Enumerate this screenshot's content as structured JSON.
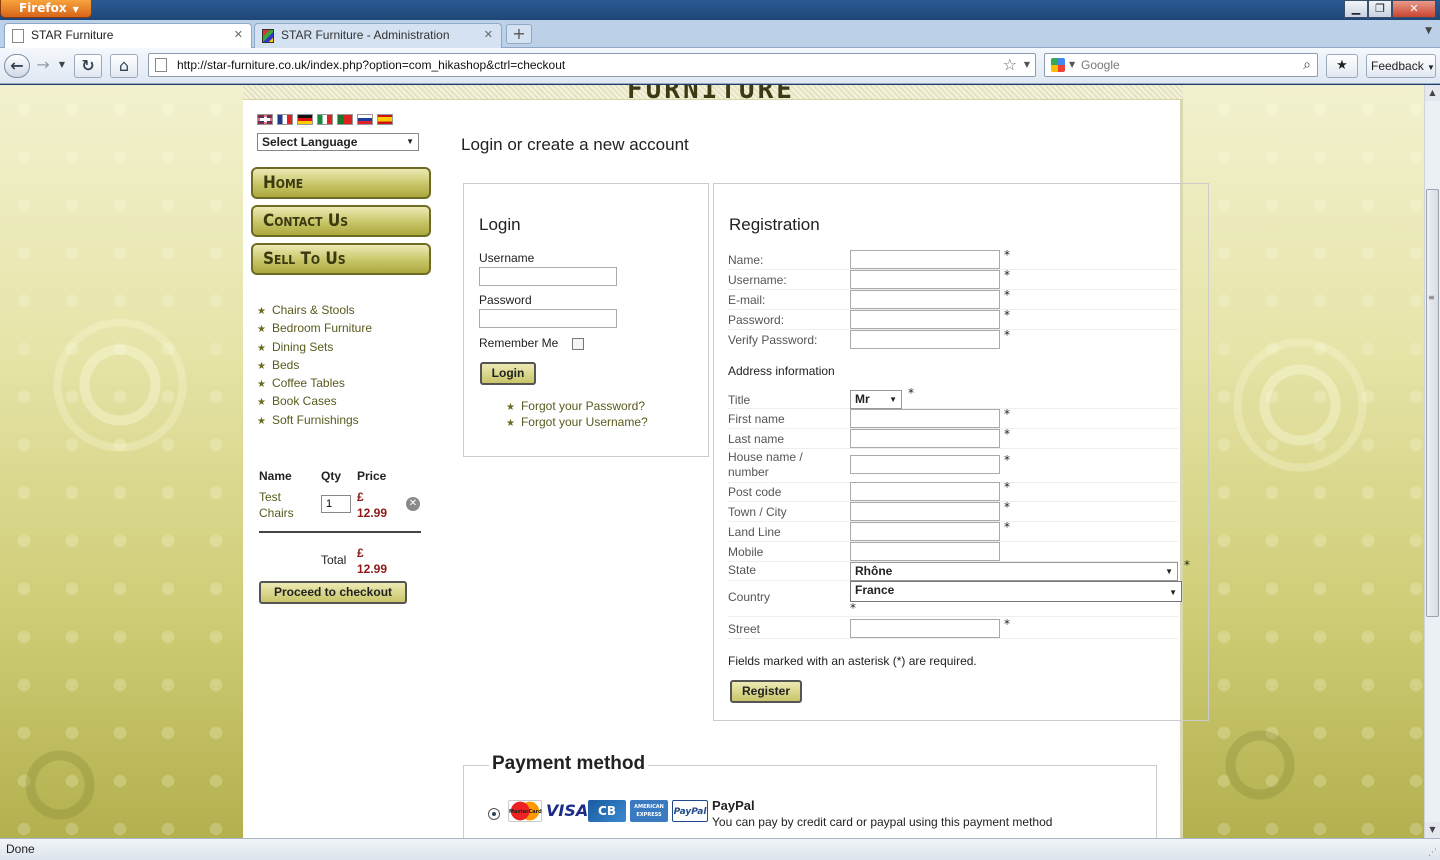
{
  "browser": {
    "app_button": "Firefox",
    "tabs": [
      {
        "label": "STAR Furniture",
        "active": true
      },
      {
        "label": "STAR Furniture - Administration",
        "active": false
      }
    ],
    "url": "http://star-furniture.co.uk/index.php?option=com_hikashop&ctrl=checkout",
    "search_placeholder": "Google",
    "feedback_label": "Feedback",
    "status": "Done"
  },
  "site": {
    "header_logo": "FURNITURE",
    "language_select": "Select Language",
    "nav": [
      "Home",
      "Contact Us",
      "Sell To Us"
    ],
    "categories": [
      "Chairs & Stools",
      "Bedroom Furniture",
      "Dining Sets",
      "Beds",
      "Coffee Tables",
      "Book Cases",
      "Soft Furnishings"
    ]
  },
  "cart": {
    "headers": {
      "name": "Name",
      "qty": "Qty",
      "price": "Price"
    },
    "item": {
      "name": "Test Chairs",
      "qty": "1",
      "price_currency": "£",
      "price_value": "12.99"
    },
    "total_label": "Total",
    "total_currency": "£",
    "total_value": "12.99",
    "checkout_label": "Proceed to checkout"
  },
  "main": {
    "title": "Login or create a new account"
  },
  "login": {
    "title": "Login",
    "username_label": "Username",
    "password_label": "Password",
    "remember_label": "Remember Me",
    "login_button": "Login",
    "forgot_password": "Forgot your Password?",
    "forgot_username": "Forgot your Username?"
  },
  "registration": {
    "title": "Registration",
    "account_fields": [
      "Name:",
      "Username:",
      "E-mail:",
      "Password:",
      "Verify Password:"
    ],
    "address_title": "Address information",
    "title_label": "Title",
    "title_value": "Mr",
    "address_fields": [
      "First name",
      "Last name",
      "House name / number",
      "Post code",
      "Town / City",
      "Land Line",
      "Mobile"
    ],
    "state_label": "State",
    "state_value": "Rhône",
    "country_label": "Country",
    "country_value": "France",
    "street_label": "Street",
    "required_marker": "*",
    "required_note": "Fields marked with an asterisk (*) are required.",
    "register_button": "Register"
  },
  "payment": {
    "title": "Payment method",
    "cards": [
      "MasterCard",
      "VISA",
      "CB",
      "AMERICAN EXPRESS",
      "PayPal"
    ],
    "method_name": "PayPal",
    "method_desc": "You can pay by credit card or paypal using this payment method"
  }
}
